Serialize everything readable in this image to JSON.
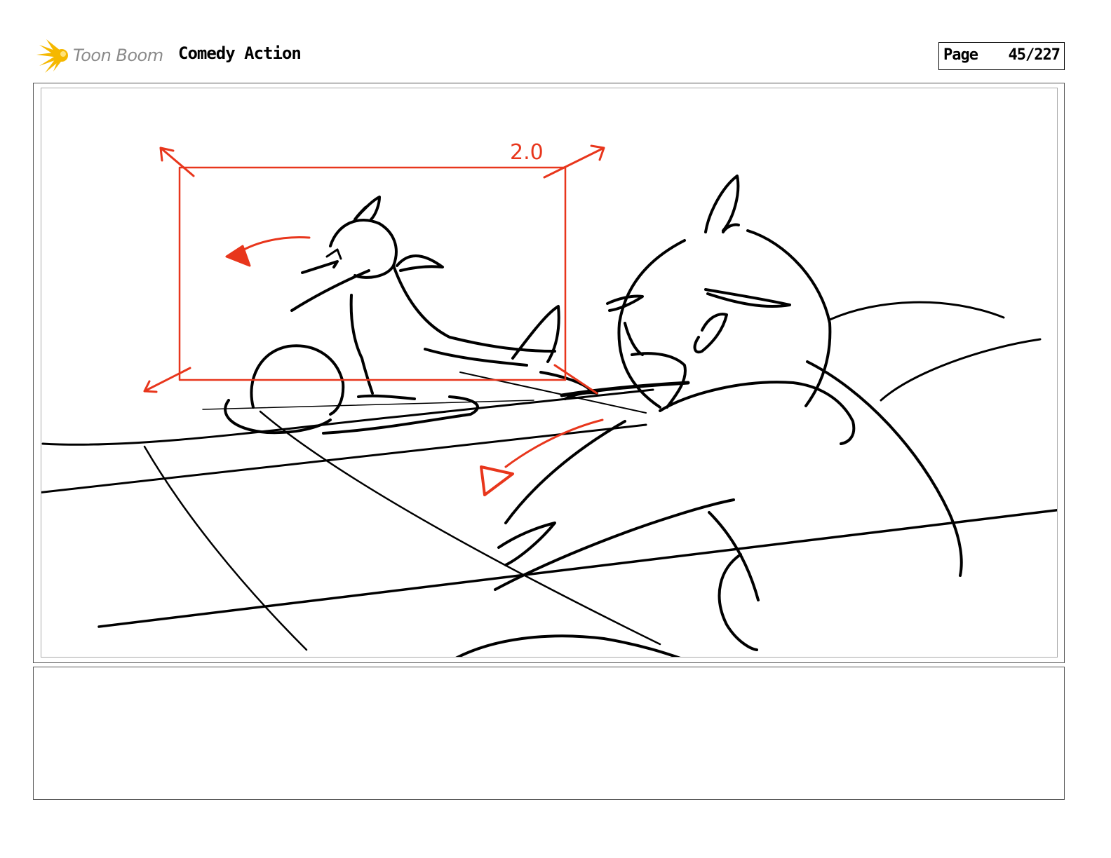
{
  "header": {
    "logo_text": "Toon Boom",
    "project_title": "Comedy Action",
    "page_label": "Page",
    "page_number": "45/227"
  },
  "panel": {
    "zoom_annotation": "2.0",
    "annotation_color": "#e8361c",
    "sketch_color": "#000000"
  },
  "caption": {
    "text": ""
  },
  "colors": {
    "logo_accent": "#f5b800"
  }
}
